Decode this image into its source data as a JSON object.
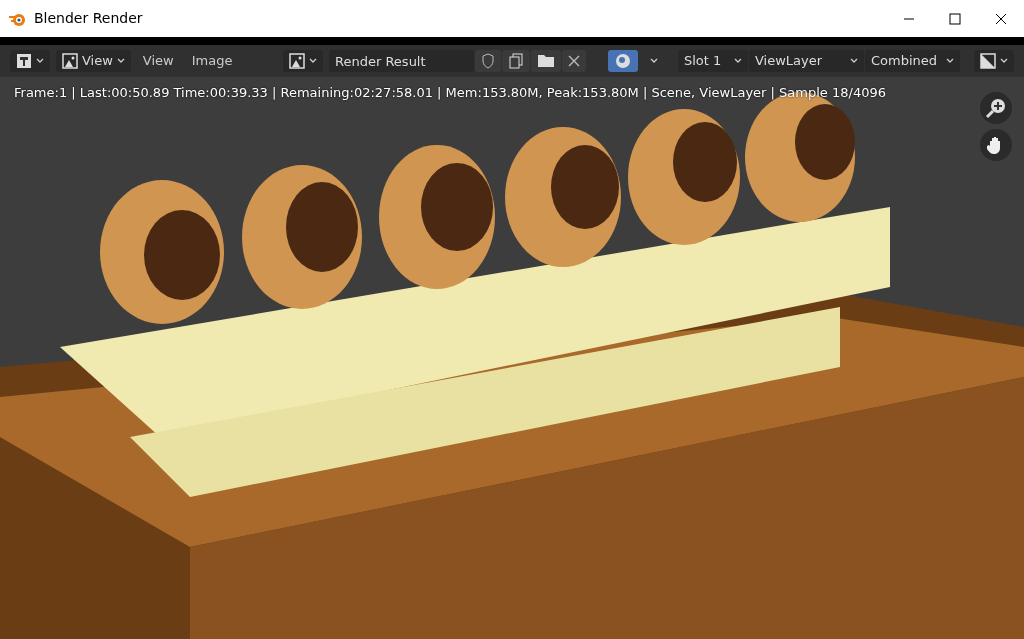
{
  "window": {
    "title": "Blender Render"
  },
  "header": {
    "view_menu": "View",
    "menus": [
      "View",
      "Image"
    ],
    "image_name": "Render Result",
    "toggle_on": true,
    "slot": "Slot 1",
    "view_layer": "ViewLayer",
    "pass": "Combined"
  },
  "status": "Frame:1 | Last:00:50.89 Time:00:39.33 | Remaining:02:27:58.01 | Mem:153.80M, Peak:153.80M | Scene, ViewLayer | Sample 18/4096"
}
